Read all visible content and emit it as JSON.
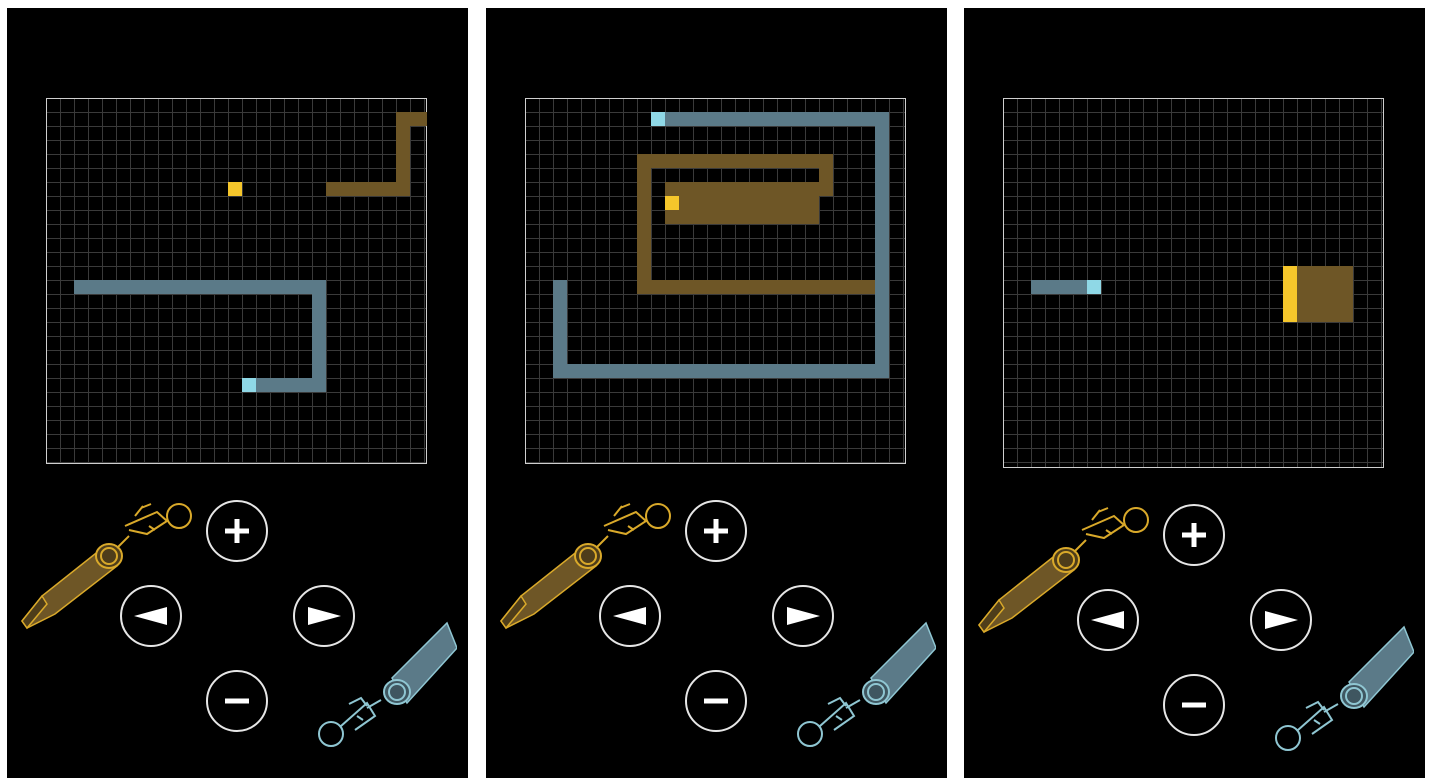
{
  "screens": [
    {
      "name": "screen-1",
      "yellow_trail": [
        [
          20,
          6
        ],
        [
          25,
          6
        ],
        [
          25,
          1
        ],
        [
          29,
          1
        ],
        [
          29,
          2
        ],
        [
          30,
          2
        ],
        [
          30,
          3
        ],
        [
          31,
          3
        ],
        [
          31,
          13
        ]
      ],
      "yellow_fill": [],
      "yellow_head": [
        13,
        6
      ],
      "blue_trail": [
        [
          14,
          20
        ],
        [
          19,
          20
        ],
        [
          19,
          13
        ],
        [
          2,
          13
        ]
      ],
      "blue_head": [
        14,
        20
      ]
    },
    {
      "name": "screen-2",
      "yellow_trail": [
        [
          10,
          8
        ],
        [
          10,
          6
        ],
        [
          21,
          6
        ],
        [
          21,
          4
        ],
        [
          8,
          4
        ],
        [
          8,
          13
        ],
        [
          25,
          13
        ]
      ],
      "yellow_fill": [
        [
          10,
          6,
          11,
          2
        ],
        [
          11,
          7,
          10,
          2
        ],
        [
          13,
          8,
          8,
          1
        ]
      ],
      "yellow_head": [
        10,
        7
      ],
      "blue_trail": [
        [
          10,
          1
        ],
        [
          25,
          1
        ],
        [
          25,
          19
        ],
        [
          2,
          19
        ],
        [
          2,
          13
        ]
      ],
      "blue_head": [
        9,
        1
      ]
    },
    {
      "name": "screen-3",
      "yellow_trail": [],
      "yellow_fill": [
        [
          20,
          12,
          5,
          4
        ]
      ],
      "yellow_bar": [
        20,
        12,
        1,
        4
      ],
      "blue_trail": [
        [
          2,
          13
        ],
        [
          6,
          13
        ]
      ],
      "blue_head": [
        6,
        13
      ]
    }
  ],
  "controls": {
    "accelerate": "+",
    "decelerate": "−",
    "turn_left": "left-arrow",
    "turn_right": "right-arrow"
  },
  "colors": {
    "background": "#000000",
    "grid_line": "#3a3a3a",
    "board_border": "#cfcfcf",
    "yellow_trail": "#6e5626",
    "yellow_head": "#f5c62b",
    "blue_trail": "#5b7a88",
    "blue_head": "#8fd8e6",
    "button_ring": "#e6e6e6"
  }
}
